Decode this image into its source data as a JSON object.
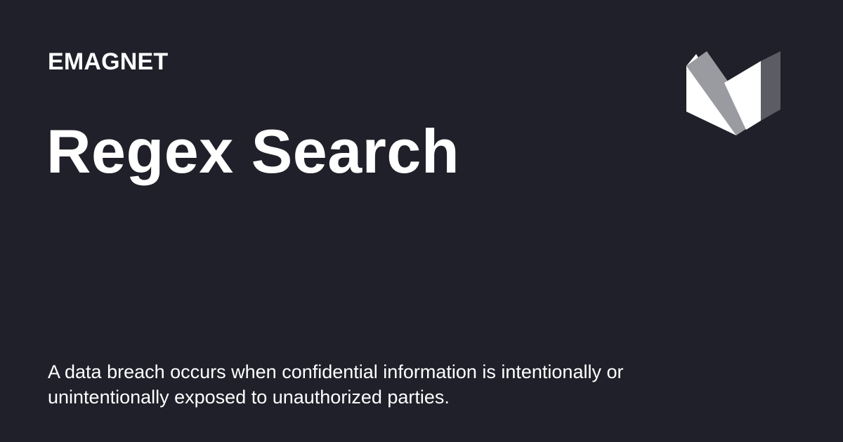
{
  "brand": {
    "name": "EMAGNET",
    "logo_icon": "emagnet-m-logo-icon"
  },
  "page": {
    "title": "Regex Search",
    "description": "A data breach occurs when confidential information is intentionally or unintentionally exposed to unauthorized parties."
  },
  "colors": {
    "background": "#1f2029",
    "text": "#ffffff",
    "logo_light": "#ffffff",
    "logo_mid": "#9a9ba1",
    "logo_dark": "#5b5c64"
  }
}
